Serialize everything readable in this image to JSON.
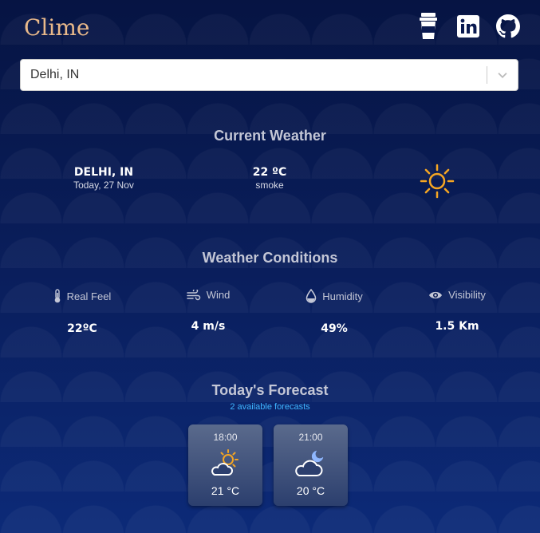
{
  "app": {
    "logo": "Clime"
  },
  "header": {
    "icons": [
      "coffee-cup-icon",
      "linkedin-icon",
      "github-icon"
    ]
  },
  "search": {
    "value": "Delhi, IN"
  },
  "current": {
    "title": "Current Weather",
    "city": "DELHI, IN",
    "date": "Today, 27 Nov",
    "temp": "22 ºC",
    "description": "smoke",
    "icon": "sun-icon"
  },
  "conditions": {
    "title": "Weather Conditions",
    "items": [
      {
        "label": "Real Feel",
        "value": "22ºC",
        "icon": "thermometer-icon"
      },
      {
        "label": "Wind",
        "value": "4 m/s",
        "icon": "wind-icon"
      },
      {
        "label": "Humidity",
        "value": "49%",
        "icon": "droplet-icon"
      },
      {
        "label": "Visibility",
        "value": "1.5 Km",
        "icon": "eye-icon"
      }
    ]
  },
  "forecast": {
    "title": "Today's Forecast",
    "subtitle": "2 available forecasts",
    "cards": [
      {
        "time": "18:00",
        "temp": "21 °C",
        "icon": "sun-cloud-icon"
      },
      {
        "time": "21:00",
        "temp": "20 °C",
        "icon": "moon-cloud-icon"
      }
    ]
  },
  "colors": {
    "accent_logo": "#e9b98a",
    "sun": "#f5a623",
    "subtitle_blue": "#3fb5ff"
  }
}
